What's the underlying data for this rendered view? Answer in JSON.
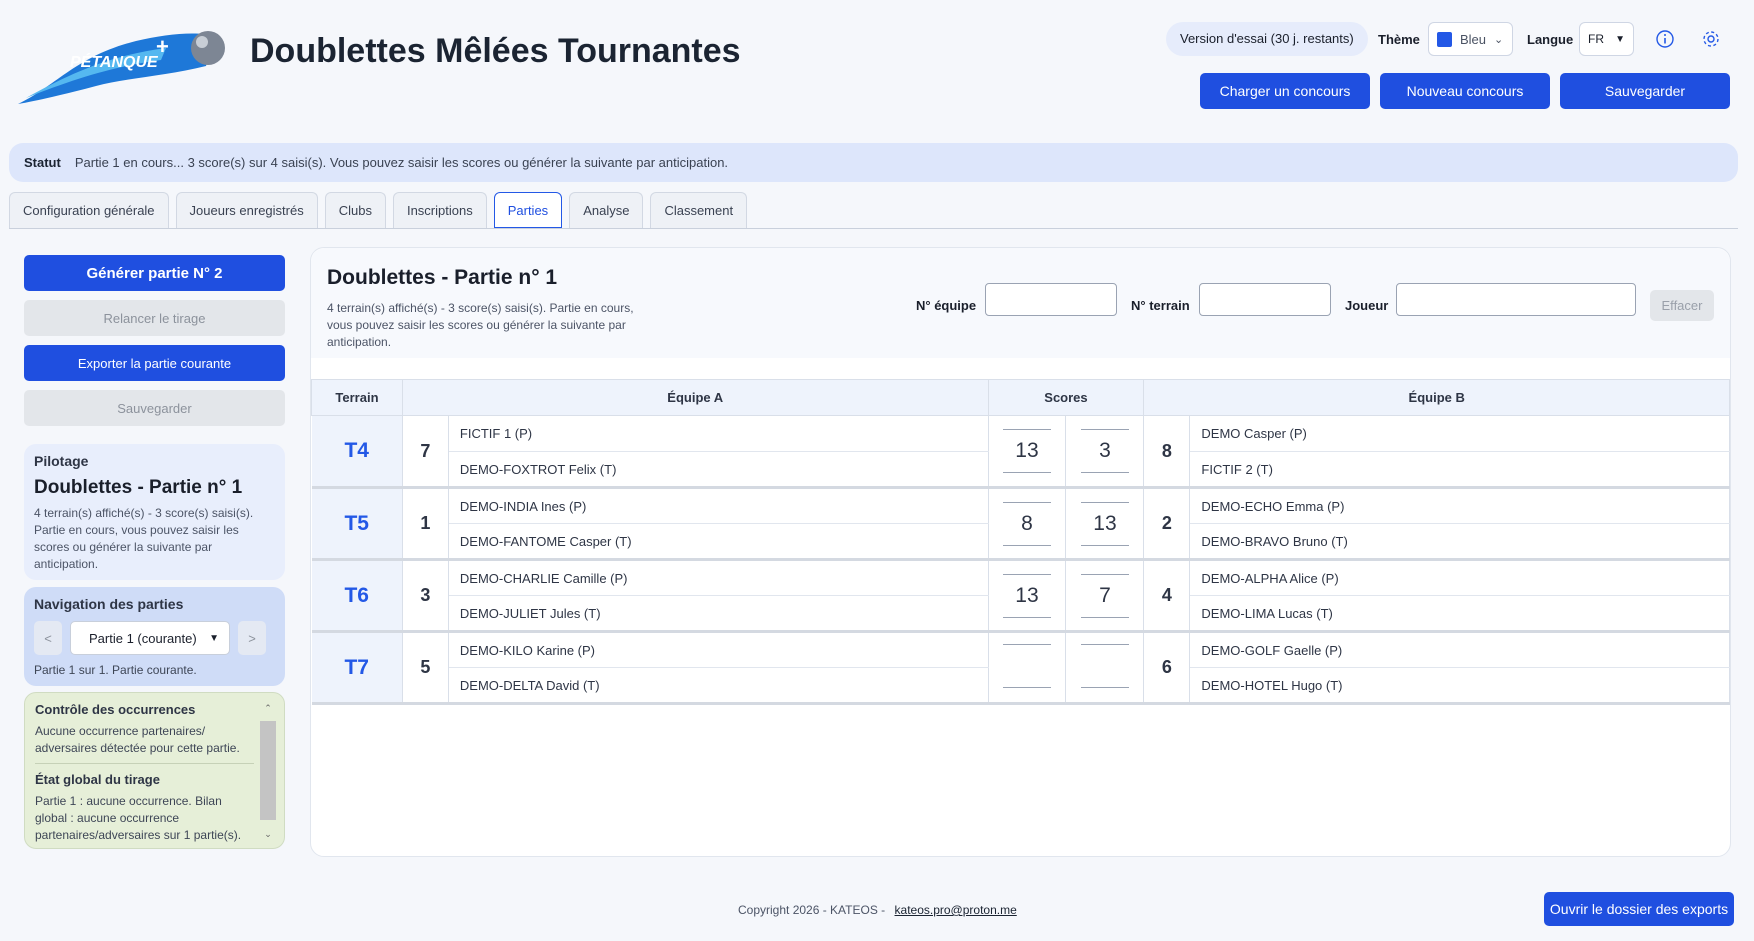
{
  "header": {
    "logo_text": "PÉTANQUE",
    "title": "Doublettes Mêlées Tournantes",
    "trial": "Version d'essai (30 j. restants)",
    "theme_label": "Thème",
    "theme_value": "Bleu",
    "theme_color": "#2358e6",
    "lang_label": "Langue",
    "lang_value": "FR",
    "buttons": {
      "load": "Charger un concours",
      "new": "Nouveau concours",
      "save": "Sauvegarder"
    }
  },
  "status": {
    "label": "Statut",
    "text": "Partie 1 en cours... 3 score(s) sur 4 saisi(s). Vous pouvez saisir les scores ou générer la suivante par anticipation."
  },
  "tabs": [
    "Configuration générale",
    "Joueurs enregistrés",
    "Clubs",
    "Inscriptions",
    "Parties",
    "Analyse",
    "Classement"
  ],
  "active_tab": "Parties",
  "sidebar": {
    "generate": "Générer partie N° 2",
    "redraw": "Relancer le tirage",
    "export": "Exporter la partie courante",
    "save": "Sauvegarder",
    "pilot": {
      "label": "Pilotage",
      "title": "Doublettes - Partie n° 1",
      "text": "4 terrain(s) affiché(s) - 3 score(s) saisi(s). Partie en cours, vous pouvez saisir les scores ou générer la suivante par anticipation."
    },
    "nav": {
      "label": "Navigation des parties",
      "prev": "<",
      "next": ">",
      "selected": "Partie 1 (courante)",
      "info": "Partie 1 sur 1. Partie courante."
    },
    "control": {
      "title1": "Contrôle des occurrences",
      "text1": "Aucune occurrence partenaires/ adversaires détectée pour cette partie.",
      "title2": "État global du tirage",
      "text2": "Partie 1 : aucune occurrence. Bilan global : aucune occurrence partenaires/adversaires sur 1 partie(s)."
    }
  },
  "main": {
    "title": "Doublettes - Partie n° 1",
    "subtitle": "4 terrain(s) affiché(s) - 3 score(s) saisi(s). Partie en cours, vous pouvez saisir les scores ou générer la suivante par anticipation.",
    "filters": {
      "team_label": "N° équipe",
      "terrain_label": "N° terrain",
      "player_label": "Joueur",
      "clear": "Effacer"
    },
    "columns": {
      "terrain": "Terrain",
      "team_a": "Équipe A",
      "scores": "Scores",
      "team_b": "Équipe B"
    },
    "matches": [
      {
        "terrain": "T4",
        "team_a": "7",
        "a1": "FICTIF 1 (P)",
        "a2": "DEMO-FOXTROT Felix (T)",
        "score_a": "13",
        "score_b": "3",
        "team_b": "8",
        "b1": "DEMO Casper (P)",
        "b2": "FICTIF 2 (T)"
      },
      {
        "terrain": "T5",
        "team_a": "1",
        "a1": "DEMO-INDIA Ines (P)",
        "a2": "DEMO-FANTOME Casper (T)",
        "score_a": "8",
        "score_b": "13",
        "team_b": "2",
        "b1": "DEMO-ECHO Emma (P)",
        "b2": "DEMO-BRAVO Bruno (T)"
      },
      {
        "terrain": "T6",
        "team_a": "3",
        "a1": "DEMO-CHARLIE Camille (P)",
        "a2": "DEMO-JULIET Jules (T)",
        "score_a": "13",
        "score_b": "7",
        "team_b": "4",
        "b1": "DEMO-ALPHA Alice (P)",
        "b2": "DEMO-LIMA Lucas (T)"
      },
      {
        "terrain": "T7",
        "team_a": "5",
        "a1": "DEMO-KILO Karine (P)",
        "a2": "DEMO-DELTA David (T)",
        "score_a": "",
        "score_b": "",
        "team_b": "6",
        "b1": "DEMO-GOLF Gaelle (P)",
        "b2": "DEMO-HOTEL Hugo (T)"
      }
    ]
  },
  "footer": {
    "copyright": "Copyright 2026 - KATEOS -",
    "email": "kateos.pro@proton.me",
    "export_button": "Ouvrir le dossier des exports"
  }
}
